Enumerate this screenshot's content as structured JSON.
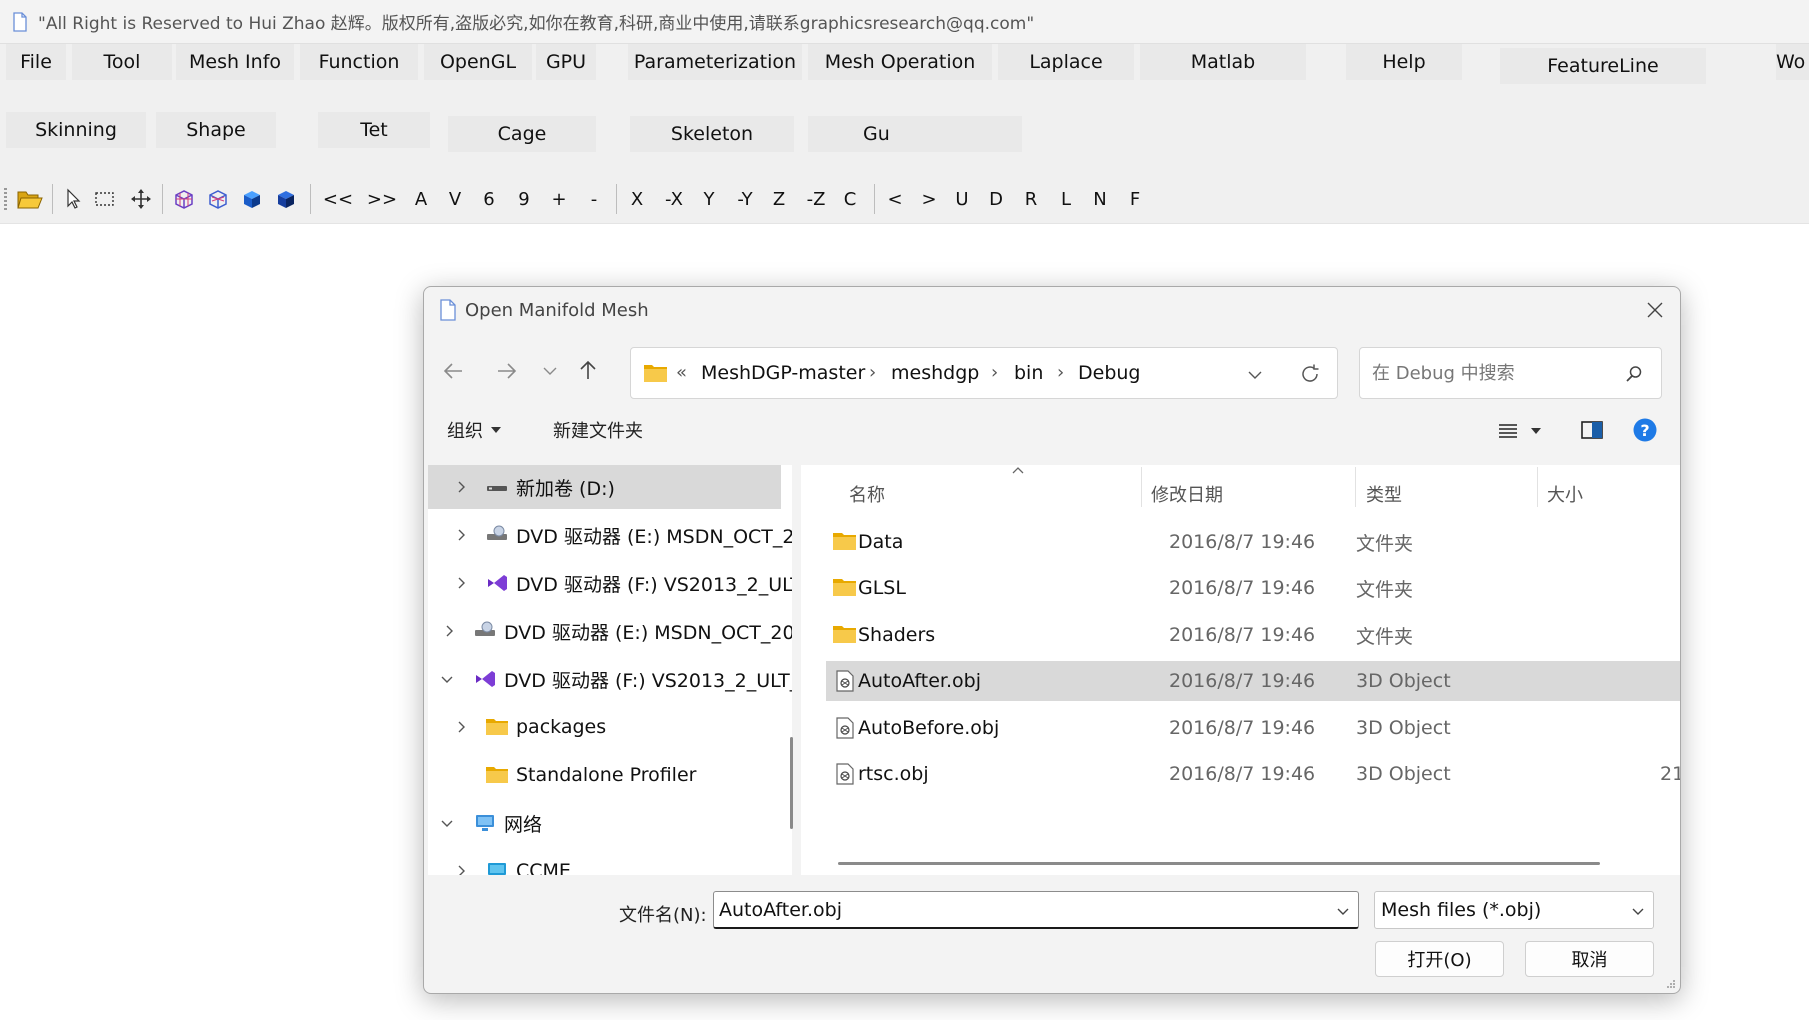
{
  "window": {
    "title": "\"All Right is Reserved to Hui Zhao 赵辉。版权所有,盗版必究,如你在教育,科研,商业中使用,请联系graphicsresearch@qq.com\""
  },
  "menubar": {
    "row1": [
      "File",
      "Tool",
      "Mesh Info",
      "Function",
      "OpenGL",
      "GPU",
      "Parameterization",
      "Mesh Operation",
      "Laplace",
      "Matlab",
      "Help",
      "FeatureLine",
      "Wo"
    ],
    "row2": [
      "Skinning",
      "Shape",
      "Tet",
      "Cage",
      "Skeleton",
      "Gu"
    ]
  },
  "toolbar": {
    "text_buttons": [
      "<<",
      ">>",
      "A",
      "V",
      "6",
      "9",
      "+",
      "-",
      "X",
      "-X",
      "Y",
      "-Y",
      "Z",
      "-Z",
      "C",
      "<",
      ">",
      "U",
      "D",
      "R",
      "L",
      "N",
      "F"
    ],
    "icons": [
      "open-folder-icon",
      "select-pointer-icon",
      "select-rect-icon",
      "move-icon",
      "wireframe-cube-icon",
      "wireframe-cube-alt-icon",
      "solid-cube-icon",
      "solid-cube-dark-icon"
    ]
  },
  "dialog": {
    "title": "Open Manifold Mesh",
    "address": {
      "overflow": "«",
      "crumbs": [
        "MeshDGP-master",
        "meshdgp",
        "bin",
        "Debug"
      ]
    },
    "search_placeholder": "在 Debug 中搜索",
    "commands": {
      "organize": "组织",
      "new_folder": "新建文件夹"
    },
    "tree": [
      {
        "label": "新加卷 (D:)",
        "icon": "drive-icon",
        "expanded": false,
        "selected": true
      },
      {
        "label": "DVD 驱动器 (E:) MSDN_OCT_2",
        "icon": "dvd-drive-icon",
        "expanded": false
      },
      {
        "label": "DVD 驱动器 (F:) VS2013_2_ULT",
        "icon": "visual-studio-icon",
        "expanded": false
      },
      {
        "label": "DVD 驱动器 (E:) MSDN_OCT_20",
        "icon": "dvd-drive-icon",
        "expanded": false
      },
      {
        "label": "DVD 驱动器 (F:) VS2013_2_ULT_(",
        "icon": "visual-studio-icon",
        "expanded": true
      },
      {
        "label": "packages",
        "icon": "folder-icon",
        "expanded": false
      },
      {
        "label": "Standalone Profiler",
        "icon": "folder-icon",
        "expanded": null
      },
      {
        "label": "网络",
        "icon": "network-icon",
        "expanded": true
      },
      {
        "label": "CCME",
        "icon": "computer-icon",
        "expanded": false
      }
    ],
    "columns": {
      "name": "名称",
      "modified": "修改日期",
      "type": "类型",
      "size": "大小"
    },
    "files": [
      {
        "name": "Data",
        "modified": "2016/8/7 19:46",
        "type": "文件夹",
        "size": "",
        "icon": "folder-icon",
        "selected": false
      },
      {
        "name": "GLSL",
        "modified": "2016/8/7 19:46",
        "type": "文件夹",
        "size": "",
        "icon": "folder-icon",
        "selected": false
      },
      {
        "name": "Shaders",
        "modified": "2016/8/7 19:46",
        "type": "文件夹",
        "size": "",
        "icon": "folder-icon",
        "selected": false
      },
      {
        "name": "AutoAfter.obj",
        "modified": "2016/8/7 19:46",
        "type": "3D Object",
        "size": "",
        "icon": "3d-object-icon",
        "selected": true
      },
      {
        "name": "AutoBefore.obj",
        "modified": "2016/8/7 19:46",
        "type": "3D Object",
        "size": "",
        "icon": "3d-object-icon",
        "selected": false
      },
      {
        "name": "rtsc.obj",
        "modified": "2016/8/7 19:46",
        "type": "3D Object",
        "size": "21",
        "icon": "3d-object-icon",
        "selected": false
      }
    ],
    "filename_label": "文件名(N):",
    "filename_value": "AutoAfter.obj",
    "filter_value": "Mesh files (*.obj)",
    "open_button": "打开(O)",
    "cancel_button": "取消"
  },
  "colors": {
    "accent": "#0067c0",
    "selection": "#d9d9d9",
    "folder": "#f5c242"
  }
}
